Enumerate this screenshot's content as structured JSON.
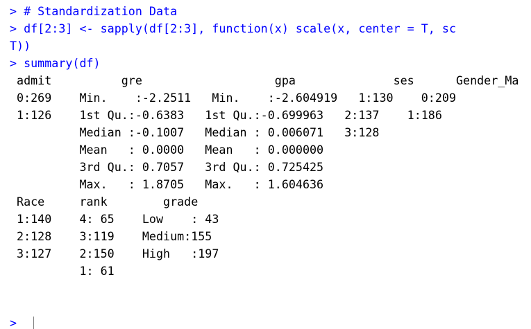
{
  "console": {
    "prompt_symbol": "> ",
    "commands": [
      "# Standardization Data",
      "df[2:3] <- sapply(df[2:3], function(x) scale(x, center = T, sc",
      "T))",
      "summary(df)"
    ],
    "output": [
      " admit          gre                   gpa              ses      Gender_Ma",
      " 0:269    Min.    :-2.2511   Min.    :-2.604919   1:130    0:209",
      " 1:126    1st Qu.:-0.6383   1st Qu.:-0.699963   2:137    1:186",
      "          Median :-0.1007   Median : 0.006071   3:128",
      "          Mean   : 0.0000   Mean   : 0.000000",
      "          3rd Qu.: 0.7057   3rd Qu.: 0.725425",
      "          Max.   : 1.8705   Max.   : 1.604636",
      " Race     rank        grade",
      " 1:140    4: 65    Low    : 43",
      " 2:128    3:119    Medium:155",
      " 3:127    2:150    High   :197",
      "          1: 61"
    ]
  }
}
